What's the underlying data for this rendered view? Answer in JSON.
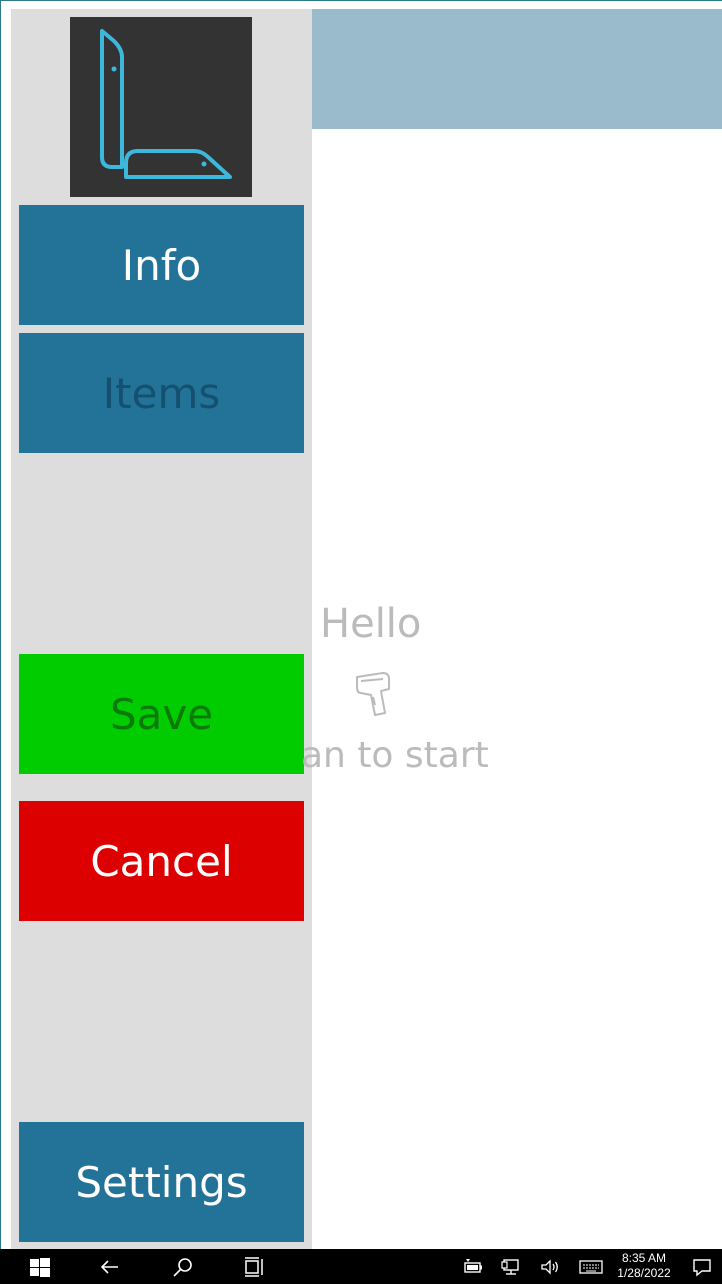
{
  "sidebar": {
    "logo_icon": "l-bracket-logo-icon",
    "buttons": {
      "info": "Info",
      "items": "Items",
      "save": "Save",
      "cancel": "Cancel",
      "settings": "Settings"
    }
  },
  "main": {
    "greeting": "Hello",
    "scanner_icon": "barcode-scanner-icon",
    "instruction": "an to start"
  },
  "taskbar": {
    "icons": [
      "windows-start-icon",
      "back-arrow-icon",
      "search-icon",
      "task-view-icon",
      "battery-icon",
      "network-icon",
      "volume-icon",
      "keyboard-icon",
      "notifications-icon"
    ],
    "time": "8:35 AM",
    "date": "1/28/2022"
  },
  "colors": {
    "sidebar_bg": "#dddddd",
    "nav_blue": "#237399",
    "save_green": "#00cc00",
    "cancel_red": "#dd0000",
    "header_band": "#99bbcc",
    "logo_bg": "#333333",
    "logo_accent": "#3db8dd"
  }
}
